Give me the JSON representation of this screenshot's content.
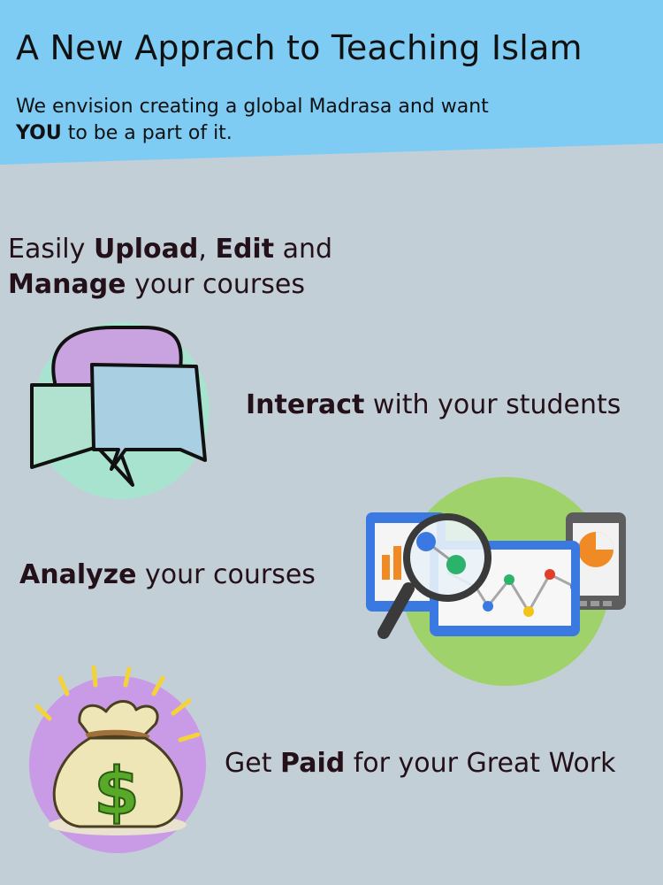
{
  "header": {
    "title": "A New Apprach to Teaching Islam",
    "subtitle_part1": "We envision creating a global Madrasa and want ",
    "subtitle_strong": "YOU",
    "subtitle_part2": " to be a part of it.",
    "background_color": "#7ecbf3"
  },
  "features": [
    {
      "items": [
        {
          "text": "Easily ",
          "bold": false
        },
        {
          "text": "Upload",
          "bold": true
        },
        {
          "text": ", ",
          "bold": false
        },
        {
          "text": "Edit",
          "bold": true
        },
        {
          "text": " and",
          "bold": false
        },
        {
          "text": "Manage",
          "bold": true,
          "newline": true
        },
        {
          "text": " your courses",
          "bold": false
        }
      ]
    },
    {
      "items": [
        {
          "text": "Interact",
          "bold": true
        },
        {
          "text": " with your students",
          "bold": false
        }
      ],
      "icon": "chat-bubbles-icon"
    },
    {
      "items": [
        {
          "text": "Analyze",
          "bold": true
        },
        {
          "text": " your courses",
          "bold": false
        }
      ],
      "icon": "analytics-magnifier-icon"
    },
    {
      "items": [
        {
          "text": "Get ",
          "bold": false
        },
        {
          "text": "Paid",
          "bold": true
        },
        {
          "text": " for your Great Work",
          "bold": false
        }
      ],
      "icon": "money-bag-icon"
    }
  ],
  "colors": {
    "page_background": "#c3cfd6",
    "chat_circle": "#a8e3d0",
    "analytics_circle": "#9fd26a",
    "money_circle": "#c99be6"
  }
}
